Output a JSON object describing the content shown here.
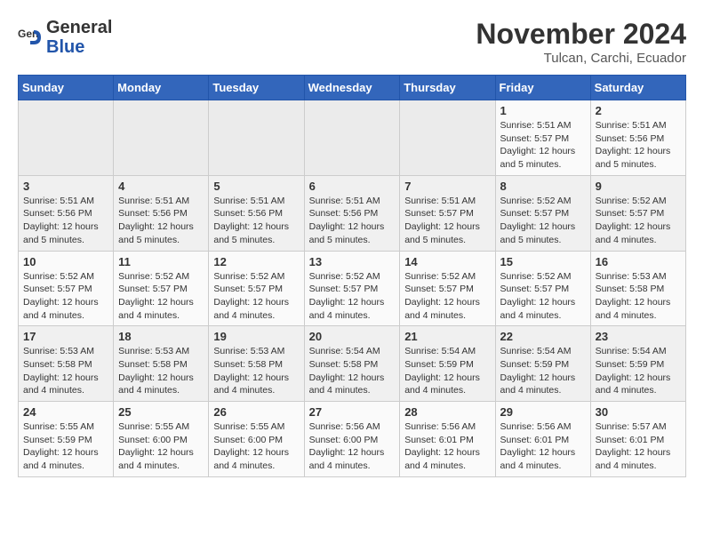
{
  "header": {
    "logo": {
      "general": "General",
      "blue": "Blue"
    },
    "title": "November 2024",
    "location": "Tulcan, Carchi, Ecuador"
  },
  "days_of_week": [
    "Sunday",
    "Monday",
    "Tuesday",
    "Wednesday",
    "Thursday",
    "Friday",
    "Saturday"
  ],
  "weeks": [
    [
      {
        "day": "",
        "empty": true
      },
      {
        "day": "",
        "empty": true
      },
      {
        "day": "",
        "empty": true
      },
      {
        "day": "",
        "empty": true
      },
      {
        "day": "",
        "empty": true
      },
      {
        "day": "1",
        "sunrise": "Sunrise: 5:51 AM",
        "sunset": "Sunset: 5:57 PM",
        "daylight": "Daylight: 12 hours and 5 minutes."
      },
      {
        "day": "2",
        "sunrise": "Sunrise: 5:51 AM",
        "sunset": "Sunset: 5:56 PM",
        "daylight": "Daylight: 12 hours and 5 minutes."
      }
    ],
    [
      {
        "day": "3",
        "sunrise": "Sunrise: 5:51 AM",
        "sunset": "Sunset: 5:56 PM",
        "daylight": "Daylight: 12 hours and 5 minutes."
      },
      {
        "day": "4",
        "sunrise": "Sunrise: 5:51 AM",
        "sunset": "Sunset: 5:56 PM",
        "daylight": "Daylight: 12 hours and 5 minutes."
      },
      {
        "day": "5",
        "sunrise": "Sunrise: 5:51 AM",
        "sunset": "Sunset: 5:56 PM",
        "daylight": "Daylight: 12 hours and 5 minutes."
      },
      {
        "day": "6",
        "sunrise": "Sunrise: 5:51 AM",
        "sunset": "Sunset: 5:56 PM",
        "daylight": "Daylight: 12 hours and 5 minutes."
      },
      {
        "day": "7",
        "sunrise": "Sunrise: 5:51 AM",
        "sunset": "Sunset: 5:57 PM",
        "daylight": "Daylight: 12 hours and 5 minutes."
      },
      {
        "day": "8",
        "sunrise": "Sunrise: 5:52 AM",
        "sunset": "Sunset: 5:57 PM",
        "daylight": "Daylight: 12 hours and 5 minutes."
      },
      {
        "day": "9",
        "sunrise": "Sunrise: 5:52 AM",
        "sunset": "Sunset: 5:57 PM",
        "daylight": "Daylight: 12 hours and 4 minutes."
      }
    ],
    [
      {
        "day": "10",
        "sunrise": "Sunrise: 5:52 AM",
        "sunset": "Sunset: 5:57 PM",
        "daylight": "Daylight: 12 hours and 4 minutes."
      },
      {
        "day": "11",
        "sunrise": "Sunrise: 5:52 AM",
        "sunset": "Sunset: 5:57 PM",
        "daylight": "Daylight: 12 hours and 4 minutes."
      },
      {
        "day": "12",
        "sunrise": "Sunrise: 5:52 AM",
        "sunset": "Sunset: 5:57 PM",
        "daylight": "Daylight: 12 hours and 4 minutes."
      },
      {
        "day": "13",
        "sunrise": "Sunrise: 5:52 AM",
        "sunset": "Sunset: 5:57 PM",
        "daylight": "Daylight: 12 hours and 4 minutes."
      },
      {
        "day": "14",
        "sunrise": "Sunrise: 5:52 AM",
        "sunset": "Sunset: 5:57 PM",
        "daylight": "Daylight: 12 hours and 4 minutes."
      },
      {
        "day": "15",
        "sunrise": "Sunrise: 5:52 AM",
        "sunset": "Sunset: 5:57 PM",
        "daylight": "Daylight: 12 hours and 4 minutes."
      },
      {
        "day": "16",
        "sunrise": "Sunrise: 5:53 AM",
        "sunset": "Sunset: 5:58 PM",
        "daylight": "Daylight: 12 hours and 4 minutes."
      }
    ],
    [
      {
        "day": "17",
        "sunrise": "Sunrise: 5:53 AM",
        "sunset": "Sunset: 5:58 PM",
        "daylight": "Daylight: 12 hours and 4 minutes."
      },
      {
        "day": "18",
        "sunrise": "Sunrise: 5:53 AM",
        "sunset": "Sunset: 5:58 PM",
        "daylight": "Daylight: 12 hours and 4 minutes."
      },
      {
        "day": "19",
        "sunrise": "Sunrise: 5:53 AM",
        "sunset": "Sunset: 5:58 PM",
        "daylight": "Daylight: 12 hours and 4 minutes."
      },
      {
        "day": "20",
        "sunrise": "Sunrise: 5:54 AM",
        "sunset": "Sunset: 5:58 PM",
        "daylight": "Daylight: 12 hours and 4 minutes."
      },
      {
        "day": "21",
        "sunrise": "Sunrise: 5:54 AM",
        "sunset": "Sunset: 5:59 PM",
        "daylight": "Daylight: 12 hours and 4 minutes."
      },
      {
        "day": "22",
        "sunrise": "Sunrise: 5:54 AM",
        "sunset": "Sunset: 5:59 PM",
        "daylight": "Daylight: 12 hours and 4 minutes."
      },
      {
        "day": "23",
        "sunrise": "Sunrise: 5:54 AM",
        "sunset": "Sunset: 5:59 PM",
        "daylight": "Daylight: 12 hours and 4 minutes."
      }
    ],
    [
      {
        "day": "24",
        "sunrise": "Sunrise: 5:55 AM",
        "sunset": "Sunset: 5:59 PM",
        "daylight": "Daylight: 12 hours and 4 minutes."
      },
      {
        "day": "25",
        "sunrise": "Sunrise: 5:55 AM",
        "sunset": "Sunset: 6:00 PM",
        "daylight": "Daylight: 12 hours and 4 minutes."
      },
      {
        "day": "26",
        "sunrise": "Sunrise: 5:55 AM",
        "sunset": "Sunset: 6:00 PM",
        "daylight": "Daylight: 12 hours and 4 minutes."
      },
      {
        "day": "27",
        "sunrise": "Sunrise: 5:56 AM",
        "sunset": "Sunset: 6:00 PM",
        "daylight": "Daylight: 12 hours and 4 minutes."
      },
      {
        "day": "28",
        "sunrise": "Sunrise: 5:56 AM",
        "sunset": "Sunset: 6:01 PM",
        "daylight": "Daylight: 12 hours and 4 minutes."
      },
      {
        "day": "29",
        "sunrise": "Sunrise: 5:56 AM",
        "sunset": "Sunset: 6:01 PM",
        "daylight": "Daylight: 12 hours and 4 minutes."
      },
      {
        "day": "30",
        "sunrise": "Sunrise: 5:57 AM",
        "sunset": "Sunset: 6:01 PM",
        "daylight": "Daylight: 12 hours and 4 minutes."
      }
    ]
  ]
}
